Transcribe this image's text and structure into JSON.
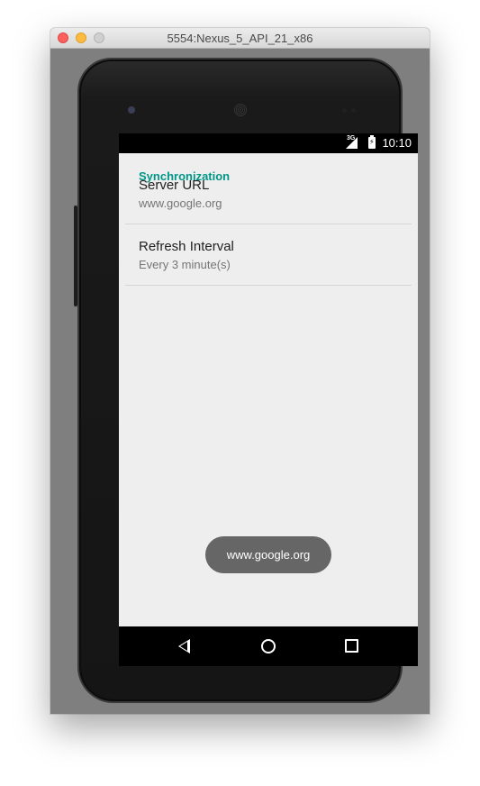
{
  "window": {
    "title": "5554:Nexus_5_API_21_x86"
  },
  "statusbar": {
    "network_type": "3G",
    "time": "10:10"
  },
  "settings": {
    "category_title": "Synchronization",
    "items": [
      {
        "title": "Server URL",
        "summary": "www.google.org"
      },
      {
        "title": "Refresh Interval",
        "summary": "Every 3 minute(s)"
      }
    ]
  },
  "toast": {
    "text": "www.google.org"
  },
  "colors": {
    "accent": "#009688",
    "background": "#eeeeee",
    "toast_background": "#666666"
  },
  "icons": {
    "navigation": [
      "back-icon",
      "home-icon",
      "recents-icon"
    ],
    "status": [
      "signal-icon",
      "battery-icon"
    ]
  }
}
